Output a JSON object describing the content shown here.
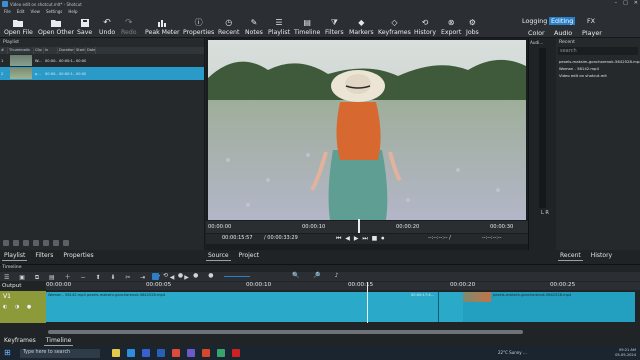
{
  "window": {
    "title": "Video edit on shotcut.mlt* - Shotcut"
  },
  "menu": [
    "File",
    "Edit",
    "View",
    "Settings",
    "Help"
  ],
  "toolbar": [
    "Open File",
    "Open Other",
    "Save",
    "Undo",
    "Redo",
    "Peak Meter",
    "Properties",
    "Recent",
    "Notes",
    "Playlist",
    "Timeline",
    "Filters",
    "Markers",
    "Keyframes",
    "History",
    "Export",
    "Jobs"
  ],
  "modes": {
    "logging": "Logging",
    "editing": "Editing",
    "fx": "FX",
    "color": "Color",
    "audio": "Audio",
    "player": "Player"
  },
  "playlist": {
    "title": "Playlist",
    "columns": [
      "#",
      "Thumbnails",
      "Clip",
      "In",
      "Duration",
      "Start",
      "Date"
    ],
    "rows": [
      {
        "n": "1",
        "clip": "W...",
        "in": "00:00...",
        "duration": "00:00:1...",
        "start": "00:00..."
      },
      {
        "n": "2",
        "clip": "p...",
        "in": "00:00...",
        "duration": "00:00:1...",
        "start": "00:00..."
      }
    ],
    "tabs": [
      "Playlist",
      "Filters",
      "Properties"
    ]
  },
  "player": {
    "ruler": [
      "00:00:00",
      "00:00:10",
      "00:00:20",
      "00:00:30"
    ],
    "position": "00:00:15:57",
    "duration": "/ 00:00:33:29",
    "in_point": "--:--:--:-- /",
    "out_point": "--:--:--:--",
    "tabs": [
      "Source",
      "Project"
    ],
    "stage_label": "Video preview"
  },
  "audio_meter": {
    "title": "Audi...",
    "lr": "L R"
  },
  "recent": {
    "title": "Recent",
    "search_placeholder": "search",
    "items": [
      "pexels-maksim-goncharenok-5642528.mp4",
      "Woman - 58142.mp4",
      "Video edit on shotcut.mlt"
    ],
    "tabs": [
      "Recent",
      "History"
    ]
  },
  "timeline": {
    "title": "Timeline",
    "ruler": [
      "00:00:00",
      "00:00:05",
      "00:00:10",
      "00:00:15",
      "00:00:20",
      "00:00:25"
    ],
    "output_label": "Output",
    "track_label": "V1",
    "clip_a": "Woman - 58142.mp4 pexels-maksim-goncharenok-5642528.mp4",
    "clip_b": "00:00:17:4...",
    "clip_c": "pexels-maksim-goncharenok-5642528.mp4"
  },
  "bottom_tabs": [
    "Keyframes",
    "Timeline"
  ],
  "taskbar": {
    "search": "Type here to search",
    "weather": "22°C  Sunny  ...",
    "time": "09:21 AM",
    "date": "05-09-2024"
  },
  "colors": {
    "accent": "#2a7fc9",
    "clip": "#2aa9c9",
    "track_head": "#8d9a3a"
  }
}
